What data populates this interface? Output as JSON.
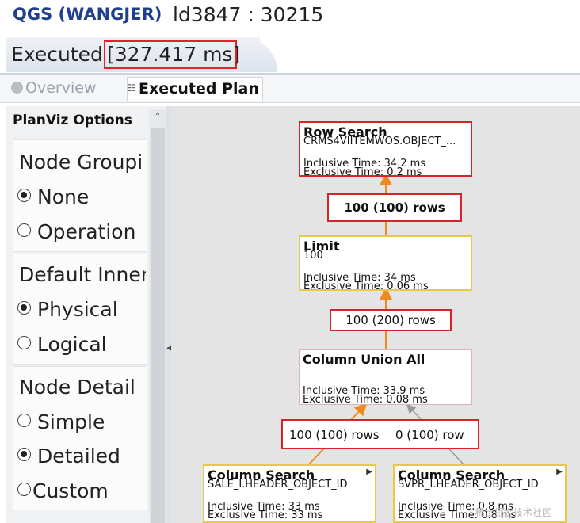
{
  "window": {
    "app_title": "QGS (WANGJER)",
    "session_id": "ld3847 : 30215"
  },
  "header": {
    "executed_label": "Executed",
    "executed_time": "[327.417 ms]"
  },
  "tabs": [
    {
      "label": "Overview",
      "active": false,
      "icon": "overview-icon"
    },
    {
      "label": "Executed Plan",
      "active": true,
      "icon": "plan-icon"
    }
  ],
  "options": {
    "title": "PlanViz Options",
    "groups": [
      {
        "title": "Node Groupi",
        "items": [
          {
            "label": "None",
            "checked": true
          },
          {
            "label": "Operation",
            "checked": false
          }
        ]
      },
      {
        "title": "Default Inner",
        "items": [
          {
            "label": "Physical",
            "checked": true
          },
          {
            "label": "Logical",
            "checked": false
          }
        ]
      },
      {
        "title": "Node Detail",
        "items": [
          {
            "label": "Simple",
            "checked": false
          },
          {
            "label": "Detailed",
            "checked": true
          },
          {
            "label": "Custom",
            "checked": false
          }
        ]
      }
    ]
  },
  "plan": {
    "nodes": [
      {
        "name": "Row Search",
        "detail": "CRMS4VIITEMWOS.OBJECT_...",
        "inclusive": "Inclusive Time: 34.2 ms",
        "exclusive": "Exclusive Time: 0.2 ms"
      },
      {
        "name": "Limit",
        "detail": "100",
        "inclusive": "Inclusive Time: 34 ms",
        "exclusive": "Exclusive Time: 0.06 ms"
      },
      {
        "name": "Column Union All",
        "detail": "",
        "inclusive": "Inclusive Time: 33.9 ms",
        "exclusive": "Exclusive Time: 0.08 ms"
      },
      {
        "name": "Column Search",
        "detail": "SALE_I.HEADER_OBJECT_ID",
        "inclusive": "Inclusive Time: 33 ms",
        "exclusive": "Exclusive Time: 33 ms"
      },
      {
        "name": "Column Search",
        "detail": "SVPR_I.HEADER_OBJECT_ID",
        "inclusive": "Inclusive Time: 0.8 ms",
        "exclusive": "Exclusive Time: 0.8 ms"
      }
    ],
    "edge_labels": {
      "limit_to_row_search": "100 (100) rows",
      "union_to_limit": "100 (200) rows",
      "sale_to_union": "100 (100) rows",
      "svpr_to_union": "0 (100) row"
    },
    "colors": {
      "edge_active": "#f08a1e",
      "edge_inactive": "#9a9a9a",
      "highlight": "#d9232a"
    }
  },
  "watermark": "稀土掘金技术社区"
}
